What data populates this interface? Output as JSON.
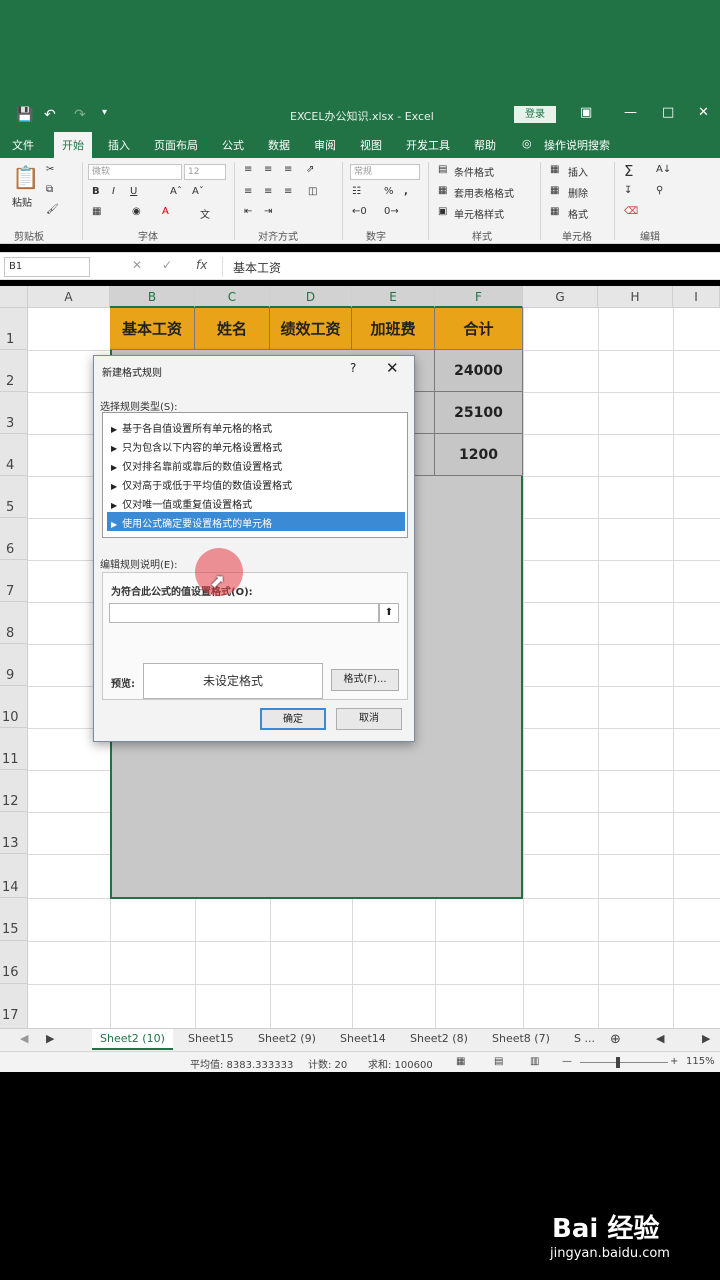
{
  "app": {
    "window_title": "EXCEL办公知识.xlsx - Excel",
    "login_label": "登录"
  },
  "tabs": [
    "文件",
    "开始",
    "插入",
    "页面布局",
    "公式",
    "数据",
    "审阅",
    "视图",
    "开发工具",
    "帮助",
    "操作说明搜索"
  ],
  "active_tab": "开始",
  "ribbon": {
    "paste_label": "粘贴",
    "font_name": "微软",
    "font_size": "12",
    "number_format": "常规",
    "conditional_format": "条件格式",
    "table_format": "套用表格格式",
    "cell_style": "单元格样式",
    "insert": "插入",
    "delete": "删除",
    "format": "格式",
    "groups": [
      "剪贴板",
      "字体",
      "对齐方式",
      "数字",
      "样式",
      "单元格",
      "编辑"
    ]
  },
  "formula_bar": {
    "name_box": "B1",
    "formula": "基本工资"
  },
  "columns": [
    "A",
    "B",
    "C",
    "D",
    "E",
    "F",
    "G",
    "H",
    "I"
  ],
  "rows": [
    "1",
    "2",
    "3",
    "4",
    "5",
    "6",
    "7",
    "8",
    "9",
    "10",
    "11",
    "12",
    "13",
    "14",
    "15",
    "16",
    "17"
  ],
  "table": {
    "headers": [
      "基本工资",
      "姓名",
      "绩效工资",
      "加班费",
      "合计"
    ],
    "totals": [
      "24000",
      "25100",
      "1200"
    ]
  },
  "dialog": {
    "title": "新建格式规则",
    "help": "?",
    "select_type_label": "选择规则类型(S):",
    "rule_types": [
      "基于各自值设置所有单元格的格式",
      "只为包含以下内容的单元格设置格式",
      "仅对排名靠前或靠后的数值设置格式",
      "仅对高于或低于平均值的数值设置格式",
      "仅对唯一值或重复值设置格式",
      "使用公式确定要设置格式的单元格"
    ],
    "selected_rule_index": 5,
    "edit_desc_label": "编辑规则说明(E):",
    "formula_label": "为符合此公式的值设置格式(O):",
    "preview_label": "预览:",
    "preview_text": "未设定格式",
    "format_button": "格式(F)...",
    "ok_button": "确定",
    "cancel_button": "取消"
  },
  "sheet_tabs": [
    "Sheet2 (10)",
    "Sheet15",
    "Sheet2 (9)",
    "Sheet14",
    "Sheet2 (8)",
    "Sheet8 (7)",
    "S ..."
  ],
  "active_sheet": "Sheet2 (10)",
  "status": {
    "average": "平均值: 8383.333333",
    "count": "计数: 20",
    "sum": "求和: 100600",
    "zoom": "115%"
  },
  "watermark": {
    "brand": "Bai 经验",
    "url": "jingyan.baidu.com"
  },
  "colors": {
    "excel_green": "#217346",
    "header_fill": "#e8a318",
    "selection_blue": "#3b8ad6"
  }
}
